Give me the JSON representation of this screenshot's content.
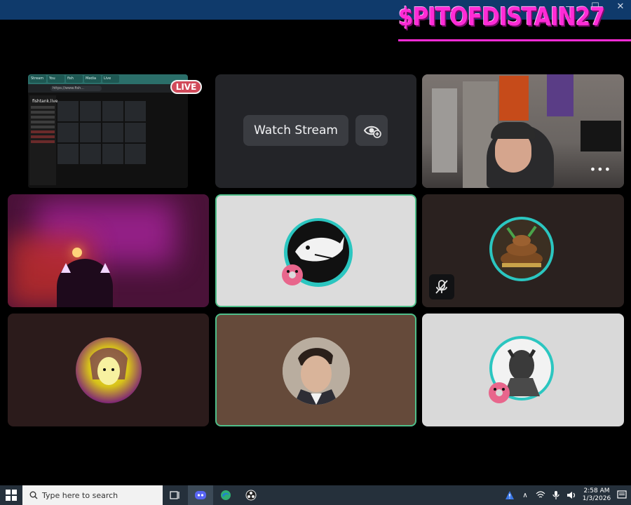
{
  "overlay": {
    "watermark": "$PITOFDISTAIN27"
  },
  "screenshare": {
    "live_badge": "LIVE",
    "url": "https://www.fish...",
    "site_name": "fishtank.live",
    "tabs": [
      "Stream",
      "You",
      "fish",
      "Media",
      "Live"
    ]
  },
  "watch_tile": {
    "watch_button": "Watch Stream"
  },
  "taskbar": {
    "search_placeholder": "Type here to search",
    "time": "2:58 AM",
    "date": "1/3/2026"
  },
  "colors": {
    "speaking_ring": "#4fbf8a",
    "live_red": "#d14a5a",
    "watermark_pink": "#ff2bd6"
  },
  "icons": [
    "windows-start-icon",
    "search-icon",
    "task-view-icon",
    "discord-icon",
    "edge-icon",
    "obs-icon",
    "warning-icon",
    "chevron-up-icon",
    "network-icon",
    "microphone-icon",
    "volume-icon",
    "notification-icon"
  ]
}
